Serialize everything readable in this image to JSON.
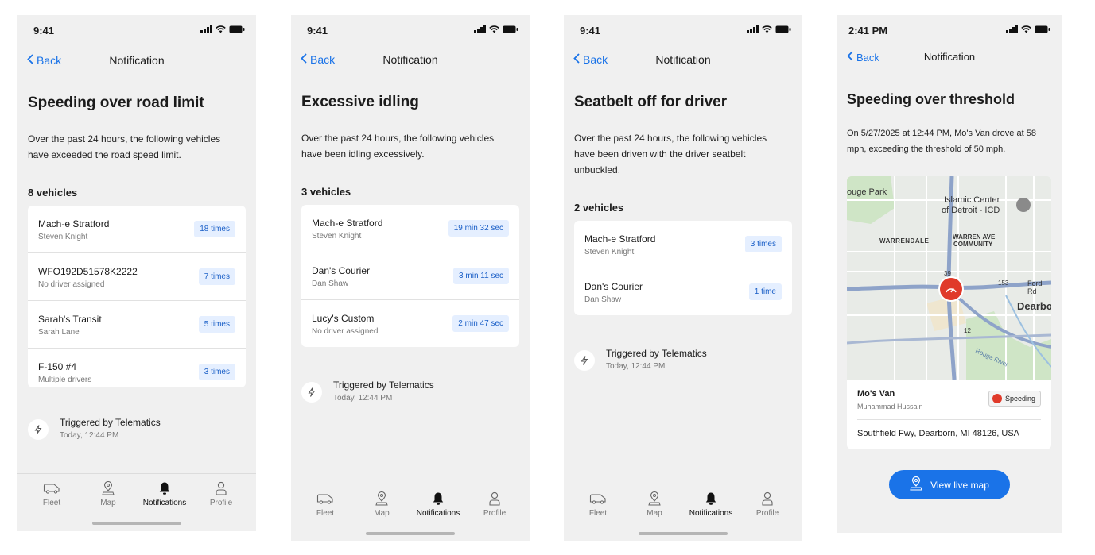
{
  "screens": [
    {
      "time": "9:41",
      "back_label": "Back",
      "nav_title": "Notification",
      "title": "Speeding over road limit",
      "description": "Over the past 24 hours, the following vehicles have exceeded the road speed limit.",
      "count_label": "8 vehicles",
      "vehicles": [
        {
          "name": "Mach-e Stratford",
          "driver": "Steven Knight",
          "badge": "18 times"
        },
        {
          "name": "WFO192D51578K2222",
          "driver": "No driver assigned",
          "badge": "7 times"
        },
        {
          "name": "Sarah's Transit",
          "driver": "Sarah Lane",
          "badge": "5 times"
        },
        {
          "name": "F-150 #4",
          "driver": "Multiple drivers",
          "badge": "3 times"
        }
      ],
      "trigger": {
        "title": "Triggered by Telematics",
        "time": "Today, 12:44 PM"
      },
      "tabs": [
        "Fleet",
        "Map",
        "Notifications",
        "Profile"
      ]
    },
    {
      "time": "9:41",
      "back_label": "Back",
      "nav_title": "Notification",
      "title": "Excessive idling",
      "description": "Over the past 24 hours, the following vehicles have been idling excessively.",
      "count_label": "3 vehicles",
      "vehicles": [
        {
          "name": "Mach-e Stratford",
          "driver": "Steven Knight",
          "badge": "19 min 32 sec"
        },
        {
          "name": "Dan's Courier",
          "driver": "Dan Shaw",
          "badge": "3 min 11 sec"
        },
        {
          "name": "Lucy's Custom",
          "driver": "No driver assigned",
          "badge": "2 min 47 sec"
        }
      ],
      "trigger": {
        "title": "Triggered by Telematics",
        "time": "Today, 12:44 PM"
      },
      "tabs": [
        "Fleet",
        "Map",
        "Notifications",
        "Profile"
      ]
    },
    {
      "time": "9:41",
      "back_label": "Back",
      "nav_title": "Notification",
      "title": "Seatbelt off for driver",
      "description": "Over the past 24 hours, the following vehicles have been driven with the driver seatbelt unbuckled.",
      "count_label": "2 vehicles",
      "vehicles": [
        {
          "name": "Mach-e Stratford",
          "driver": "Steven Knight",
          "badge": "3 times"
        },
        {
          "name": "Dan's Courier",
          "driver": "Dan Shaw",
          "badge": "1 time"
        }
      ],
      "trigger": {
        "title": "Triggered by Telematics",
        "time": "Today, 12:44 PM"
      },
      "tabs": [
        "Fleet",
        "Map",
        "Notifications",
        "Profile"
      ]
    },
    {
      "time": "2:41 PM",
      "back_label": "Back",
      "nav_title": "Notification",
      "title": "Speeding over threshold",
      "description": "On 5/27/2025 at 12:44 PM, Mo's Van drove at 58 mph, exceeding the threshold of 50 mph.",
      "map": {
        "labels": {
          "rouge_park": "ouge Park",
          "islamic_center_1": "Islamic Center",
          "islamic_center_2": "of Detroit - ICD",
          "warrendale": "WARRENDALE",
          "warren_ave_1": "WARREN AVE",
          "warren_ave_2": "COMMUNITY",
          "dearborn": "Dearbo",
          "ford_rd": "Ford Rd",
          "rouge_river": "Rouge River",
          "route_153": "153",
          "route_12": "12",
          "route_39": "39"
        }
      },
      "vehicle": {
        "name": "Mo's Van",
        "driver": "Muhammad Hussain",
        "badge": "Speeding",
        "address": "Southfield Fwy, Dearborn, MI 48126, USA"
      },
      "button_label": "View live map"
    }
  ],
  "colors": {
    "accent": "#1a73e8",
    "badge_bg": "#e5efff",
    "alert": "#e03a2a"
  }
}
